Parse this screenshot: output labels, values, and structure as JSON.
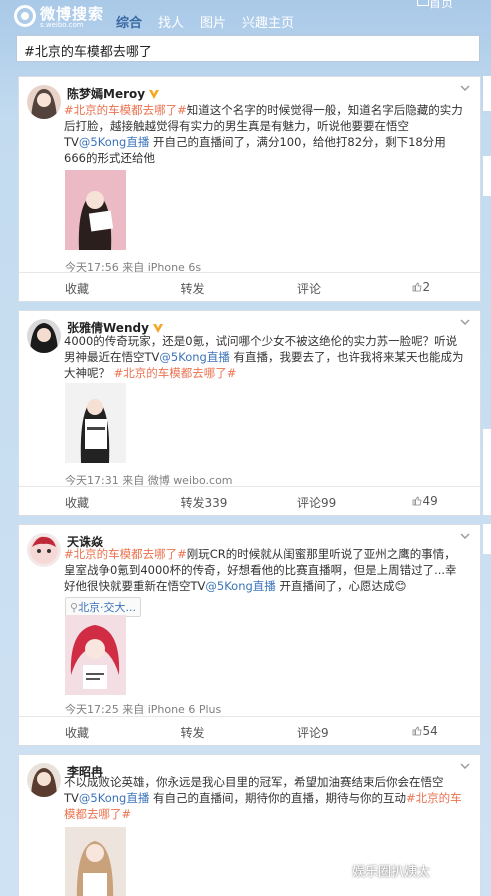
{
  "header": {
    "logo_main": "微博搜索",
    "logo_sub": "s.weibo.com",
    "nav": [
      "综合",
      "找人",
      "图片",
      "兴趣主页"
    ],
    "top_right": "首页"
  },
  "search": {
    "value": "#北京的车模都去哪了"
  },
  "posts": [
    {
      "name": "陈梦嫣Meroy",
      "segments": [
        {
          "t": "tag",
          "v": "#北京的车模都去哪了#"
        },
        {
          "t": "text",
          "v": "知道这个名字的时候觉得一般，知道名字后隐藏的实力后打脸，越接触越觉得有实力的男生真是有魅力，听说他要要在悟空TV"
        },
        {
          "t": "at",
          "v": "@5Kong直播"
        },
        {
          "t": "text",
          "v": " 开自己的直播间了，满分100，给他打82分，剩下18分用666的形式还给他"
        }
      ],
      "time": "今天17:56 来自 iPhone 6s",
      "actions": [
        "收藏",
        "转发",
        "评论",
        "2"
      ]
    },
    {
      "name": "张雅倩Wendy",
      "segments": [
        {
          "t": "text",
          "v": "4000的传奇玩家，还是0氪，试问哪个少女不被这绝伦的实力苏一脸呢？听说男神最近在悟空TV"
        },
        {
          "t": "at",
          "v": "@5Kong直播"
        },
        {
          "t": "text",
          "v": " 有直播，我要去了，也许我将来某天也能成为大神呢？ "
        },
        {
          "t": "tag",
          "v": "#北京的车模都去哪了#"
        }
      ],
      "time": "今天17:31 来自 微博 weibo.com",
      "actions": [
        "收藏",
        "转发339",
        "评论99",
        "49"
      ]
    },
    {
      "name": "天诛焱",
      "segments": [
        {
          "t": "tag",
          "v": "#北京的车模都去哪了#"
        },
        {
          "t": "text",
          "v": "刚玩CR的时候就从闺蜜那里听说了亚州之鹰的事情，皇室战争0氪到4000杯的传奇，好想看他的比赛直播啊，但是上周错过了...幸好他很快就要重新在悟空TV"
        },
        {
          "t": "at",
          "v": "@5Kong直播"
        },
        {
          "t": "text",
          "v": " 开直播间了，心愿达成😊"
        }
      ],
      "location": "北京·交大...",
      "time": "今天17:25 来自 iPhone 6 Plus",
      "actions": [
        "收藏",
        "转发",
        "评论9",
        "54"
      ]
    },
    {
      "name": "李昭冉",
      "segments": [
        {
          "t": "text",
          "v": "不以成败论英雄，你永远是我心目里的冠军，希望加油赛结束后你会在悟空TV"
        },
        {
          "t": "at",
          "v": "@5Kong直播"
        },
        {
          "t": "text",
          "v": " 有自己的直播间，期待你的直播，期待与你的互动"
        },
        {
          "t": "tag",
          "v": "#北京的车模都去哪了#"
        }
      ]
    }
  ],
  "watermark": "娱乐圈扒姨太",
  "colors": {
    "tag": "#eb7350",
    "link": "#3b73b9",
    "background": "#c3dbef",
    "vip": "#f5a623"
  }
}
